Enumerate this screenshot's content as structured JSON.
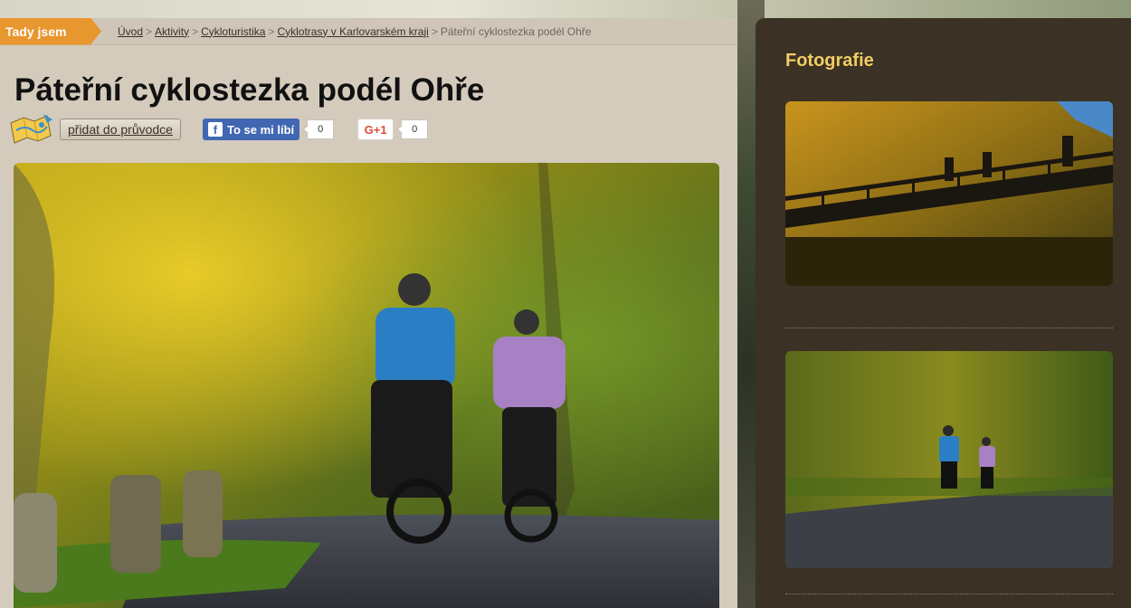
{
  "breadcrumb": {
    "here_label": "Tady jsem",
    "items": [
      "Úvod",
      "Aktivity",
      "Cykloturistika",
      "Cyklotrasy v Karlovarském kraji"
    ],
    "separator": ">",
    "current": "Páteřní cyklostezka podél Ohře"
  },
  "page": {
    "title": "Páteřní cyklostezka podél Ohře"
  },
  "actions": {
    "guide_label": "přidat do průvodce",
    "facebook_label": "To se mi líbí",
    "facebook_count": "0",
    "gplus_label": "G+1",
    "gplus_count": "0"
  },
  "sidebar": {
    "title": "Fotografie"
  },
  "colors": {
    "accent_orange": "#e8962e",
    "sidebar_bg": "#3b3125",
    "sidebar_title": "#f2cd62",
    "facebook_blue": "#4267b2",
    "gplus_red": "#dd4b39",
    "content_bg": "#d4cbbd"
  },
  "icons": {
    "guide": "map-guide-icon",
    "facebook": "facebook-icon"
  }
}
